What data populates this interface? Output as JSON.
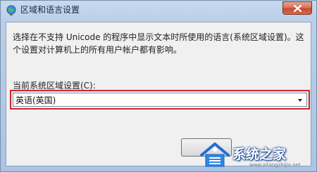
{
  "window": {
    "title": "区域和语言设置",
    "icon": "globe-icon",
    "close_icon": "close-icon"
  },
  "dialog": {
    "description": "选择在不支持 Unicode 的程序中显示文本时所使用的语言(系统区域设置)。这个设置对计算机上的所有用户帐户都有影响。",
    "current_locale_label": "当前系统区域设置(C):",
    "current_locale_value": "英语(英国)",
    "highlight_color": "#d0252c"
  },
  "watermark": {
    "logo": "house-logo",
    "text": "系统之家",
    "url": "www.xitongzhijia.net"
  }
}
